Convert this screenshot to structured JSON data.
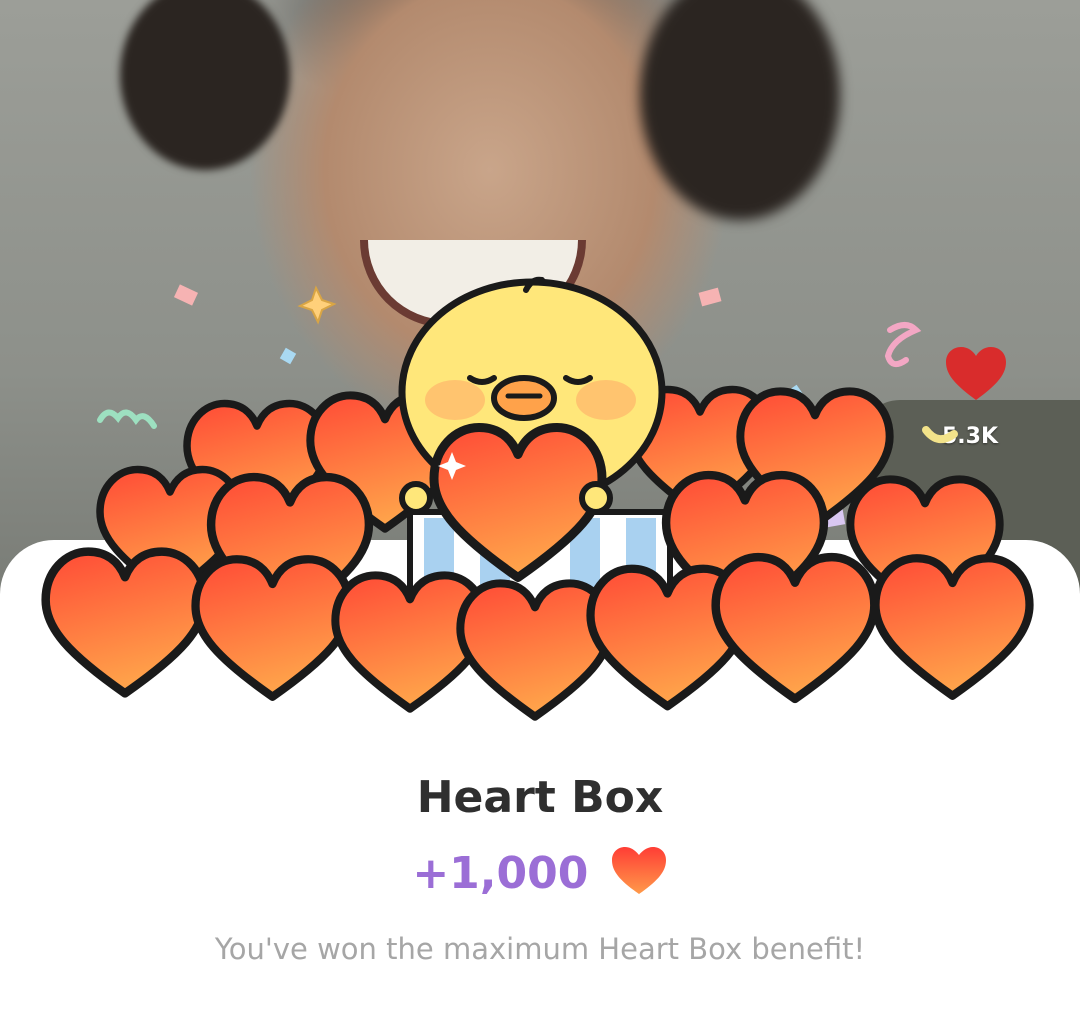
{
  "likes": {
    "count": "5.3K"
  },
  "reward": {
    "title": "Heart Box",
    "amount": "+1,000",
    "message": "You've won the maximum Heart Box benefit!"
  },
  "colors": {
    "heart_light": "#ffa24a",
    "heart_dark": "#ff3d35",
    "heart_outline": "#1a1a1a",
    "chick": "#ffe77a",
    "amount": "#9b6ed6",
    "title": "#2f2f2f",
    "subtitle": "#a6a6a6",
    "like_heart": "#d92c2c"
  },
  "icons": [
    "heart-icon",
    "chick-character",
    "gift-box-icon",
    "confetti"
  ]
}
